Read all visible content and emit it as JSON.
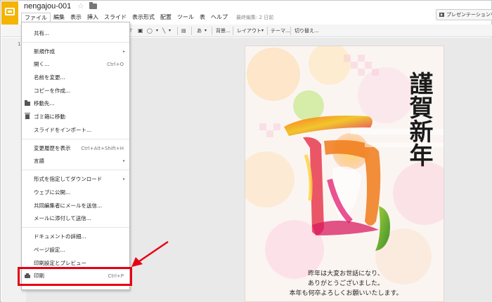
{
  "app": {
    "document_title": "nengajou-001",
    "last_edit": "最終編集: 2 日前",
    "present_button_label": "プレゼンテーションを開始",
    "slide_number": "1"
  },
  "menubar": {
    "items": [
      "ファイル",
      "編集",
      "表示",
      "挿入",
      "スライド",
      "表示形式",
      "配置",
      "ツール",
      "表",
      "ヘルプ"
    ]
  },
  "toolbar": {
    "text_tool": "あ",
    "background": "背景...",
    "layout": "レイアウト",
    "theme": "テーマ...",
    "transition": "切り替え..."
  },
  "file_menu": {
    "items": [
      {
        "label": "共有..."
      },
      {
        "label": "新規作成",
        "submenu": "▸"
      },
      {
        "label": "開く...",
        "shortcut": "Ctrl+O"
      },
      {
        "label": "名前を変更..."
      },
      {
        "label": "コピーを作成..."
      },
      {
        "label": "移動先..."
      },
      {
        "label": "ゴミ箱に移動"
      },
      {
        "label": "スライドをインポート..."
      },
      {
        "label": "変更履歴を表示",
        "shortcut": "Ctrl+Alt+Shift+H"
      },
      {
        "label": "言語",
        "submenu": "▸"
      },
      {
        "label": "形式を指定してダウンロード",
        "submenu": "▸"
      },
      {
        "label": "ウェブに公開..."
      },
      {
        "label": "共同編集者にメールを送信..."
      },
      {
        "label": "メールに添付して送信..."
      },
      {
        "label": "ドキュメントの詳細..."
      },
      {
        "label": "ページ設定..."
      },
      {
        "label": "印刷設定とプレビュー"
      },
      {
        "label": "印刷",
        "shortcut": "Ctrl+P"
      }
    ]
  },
  "slide": {
    "greeting_title": "謹賀新年",
    "message_lines": [
      "昨年は大変お世話になり、",
      "ありがとうございました。",
      "本年も何卒よろしくお願いいたします。"
    ]
  },
  "colors": {
    "logo": "#f4b400",
    "highlight": "#e60012",
    "arrow": "#e60012"
  }
}
